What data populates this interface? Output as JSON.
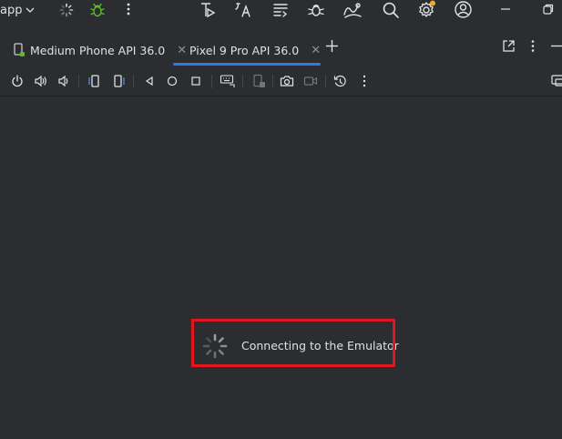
{
  "header": {
    "run_config": "app"
  },
  "device_tabs": [
    {
      "label": "Medium Phone API 36.0",
      "active": false
    },
    {
      "label": "Pixel 9 Pro API 36.0",
      "active": true
    }
  ],
  "emulator": {
    "status_text": "Connecting to the Emulator"
  },
  "colors": {
    "accent": "#3574f0",
    "highlight": "#e3151a",
    "background": "#2b2d30",
    "debug_green": "#5fb832",
    "notification_dot": "#f5a623"
  },
  "icons": {
    "run_config": "android-app-icon",
    "sync": "loading-spinner-icon",
    "debug": "bug-icon",
    "more": "more-vertical-icon",
    "profiler": "profile-icon",
    "translate": "translate-icon",
    "logcat": "logcat-icon",
    "attach": "attach-debugger-icon",
    "analyze": "analyze-icon",
    "search": "search-icon",
    "settings": "gear-icon",
    "account": "account-icon"
  }
}
